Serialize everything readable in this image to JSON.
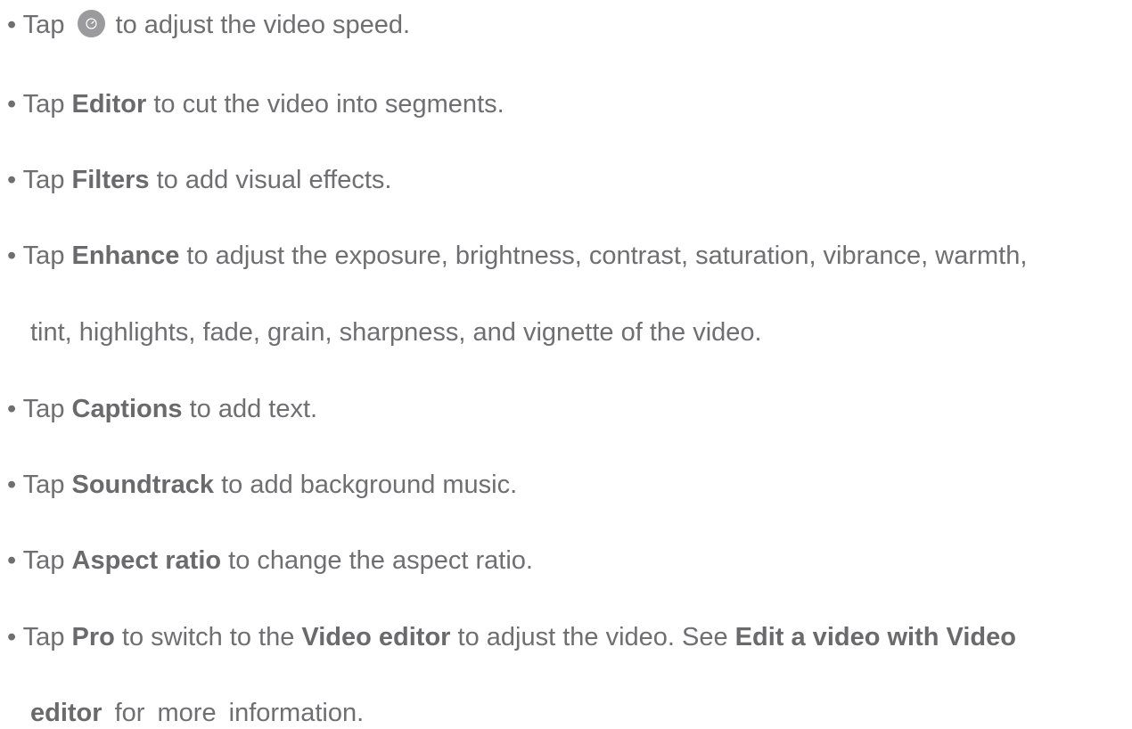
{
  "items": [
    {
      "pre": "• Tap ",
      "icon": "speed-icon",
      "post": " to adjust the video speed."
    },
    {
      "pre": "• Tap ",
      "bold": "Editor",
      "post": " to cut the video into segments."
    },
    {
      "pre": "• Tap ",
      "bold": "Filters",
      "post": " to add visual effects."
    },
    {
      "pre": "• Tap ",
      "bold": "Enhance",
      "post": " to adjust the exposure, brightness, contrast, saturation, vibrance, warmth,"
    },
    {
      "cont": "tint, highlights, fade, grain, sharpness, and vignette of the video."
    },
    {
      "pre": "• Tap ",
      "bold": "Captions",
      "post": " to add text."
    },
    {
      "pre": "• Tap ",
      "bold": "Soundtrack",
      "post": " to add background music."
    },
    {
      "pre": "• Tap ",
      "bold": "Aspect ratio",
      "post": " to change the aspect ratio."
    },
    {
      "pre": "• Tap ",
      "bold": "Pro",
      "mid1": " to switch to the ",
      "bold2": "Video editor",
      "mid2": " to adjust the video. See ",
      "bold3": "Edit a video with Video"
    },
    {
      "bold": "editor",
      "post": " for more information."
    }
  ]
}
